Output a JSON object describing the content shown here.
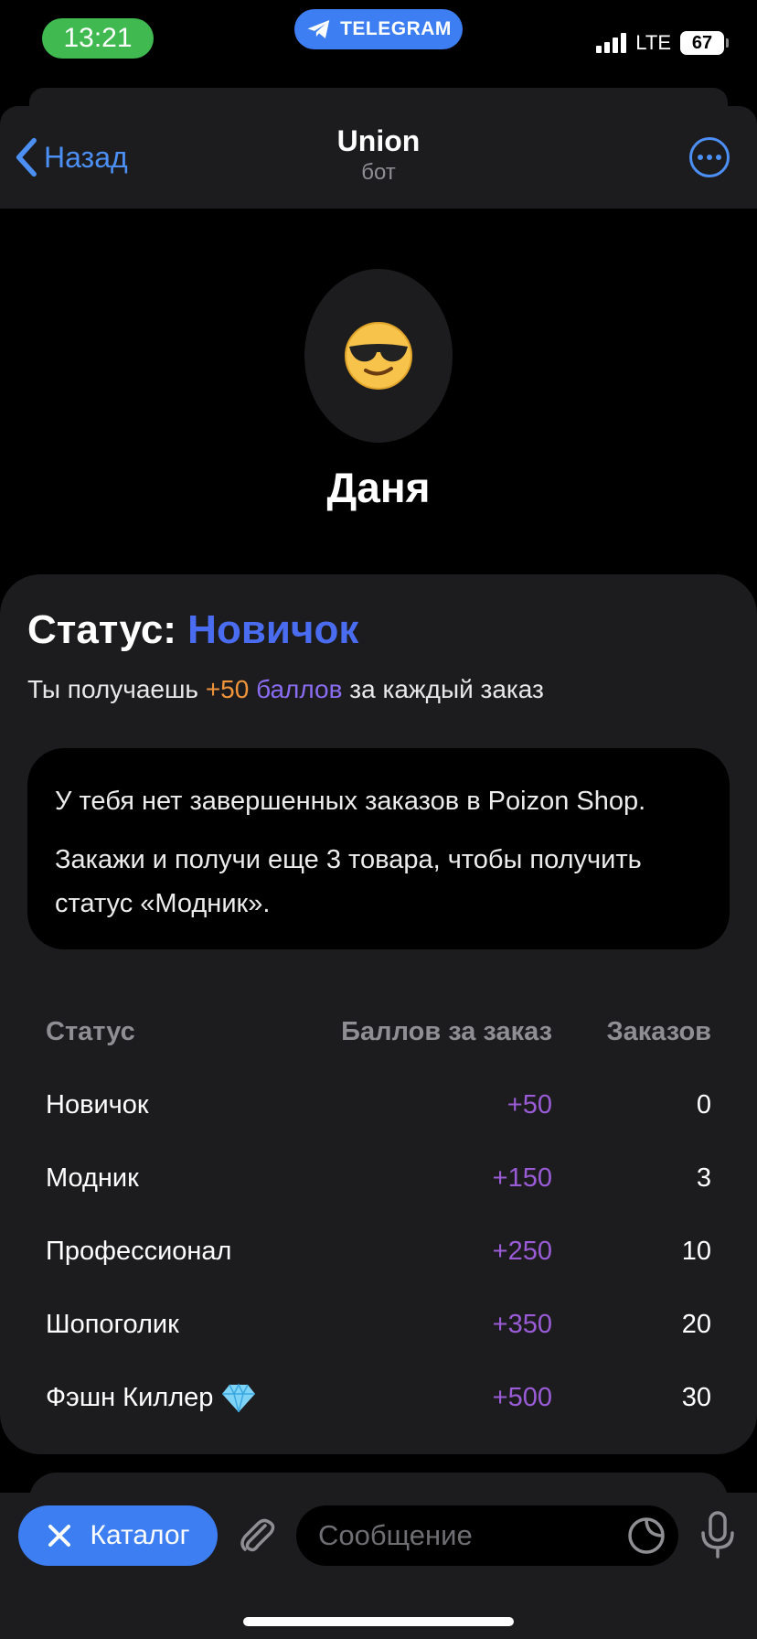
{
  "status_bar": {
    "time": "13:21",
    "telegram_label": "TELEGRAM",
    "network": "LTE",
    "battery": "67"
  },
  "nav": {
    "back_label": "Назад",
    "title": "Union",
    "subtitle": "бот"
  },
  "profile": {
    "name": "Даня",
    "avatar_icon": "sunglasses-emoji-icon"
  },
  "status_card": {
    "status_label": "Статус:",
    "status_value": "Новичок",
    "gain_prefix": "Ты получаешь",
    "gain_points": "+50",
    "gain_word": "баллов",
    "gain_suffix": "за каждый заказ",
    "info_line1": "У тебя нет завершенных заказов в Poizon Shop.",
    "info_line2": "Закажи и получи еще 3 товара, чтобы получить статус «Модник».",
    "table": {
      "headers": [
        "Статус",
        "Баллов за заказ",
        "Заказов"
      ],
      "rows": [
        {
          "status": "Новичок",
          "points": "+50",
          "orders": "0"
        },
        {
          "status": "Модник",
          "points": "+150",
          "orders": "3"
        },
        {
          "status": "Профессионал",
          "points": "+250",
          "orders": "10"
        },
        {
          "status": "Шопоголик",
          "points": "+350",
          "orders": "20"
        },
        {
          "status": "Фэшн Киллер",
          "points": "+500",
          "orders": "30"
        }
      ]
    }
  },
  "bottom_bar": {
    "catalog_label": "Каталог",
    "message_placeholder": "Сообщение"
  },
  "colors": {
    "accent": "#3d7ef2",
    "status_value": "#4a6cf0",
    "points": "#9a5cd6",
    "gain_points": "#f0943b",
    "card_bg": "#1c1c1e"
  }
}
